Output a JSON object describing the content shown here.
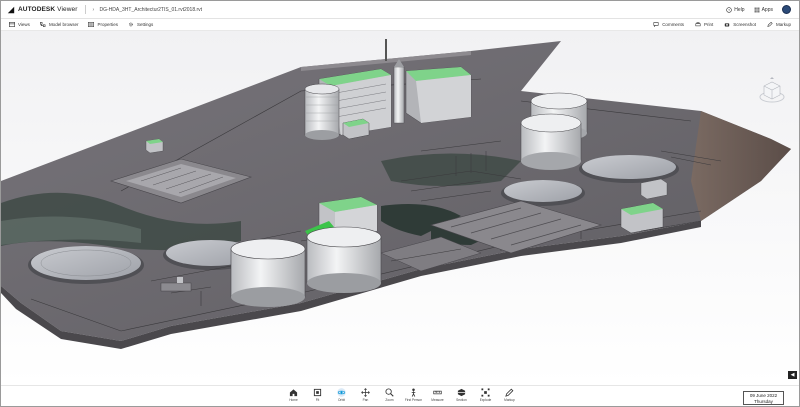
{
  "app": {
    "brand": "AUTODESK",
    "product": "Viewer",
    "filename": "DG-HDA_3HT_Architectur2TIS_01.rvt2018.rvt"
  },
  "header_right": {
    "help": "Help",
    "apps": "Apps"
  },
  "toolbar_left": [
    {
      "label": "Views",
      "icon": "views-icon"
    },
    {
      "label": "Model browser",
      "icon": "model-browser-icon"
    },
    {
      "label": "Properties",
      "icon": "properties-icon"
    },
    {
      "label": "Settings",
      "icon": "settings-icon"
    }
  ],
  "toolbar_right": [
    {
      "label": "Comments",
      "icon": "comments-icon"
    },
    {
      "label": "Print",
      "icon": "print-icon"
    },
    {
      "label": "Screenshot",
      "icon": "screenshot-icon"
    },
    {
      "label": "Markup",
      "icon": "markup-icon"
    }
  ],
  "bottom_tools": [
    {
      "label": "Home",
      "icon": "home-icon"
    },
    {
      "label": "Fit",
      "icon": "fit-icon"
    },
    {
      "label": "Orbit",
      "icon": "orbit-icon",
      "active": true
    },
    {
      "label": "Pan",
      "icon": "pan-icon"
    },
    {
      "label": "Zoom",
      "icon": "zoom-icon"
    },
    {
      "label": "First Person",
      "icon": "first-person-icon"
    },
    {
      "label": "Measure",
      "icon": "measure-icon"
    },
    {
      "label": "Section",
      "icon": "section-icon"
    },
    {
      "label": "Explode",
      "icon": "explode-icon"
    },
    {
      "label": "Markup",
      "icon": "markup-tool-icon"
    }
  ],
  "datebox": {
    "date": "09 June 2022",
    "day": "Thursday"
  },
  "colors": {
    "accent": "#0696d7",
    "roof_green": "#7fd38a",
    "ground": "#6e6c70"
  }
}
